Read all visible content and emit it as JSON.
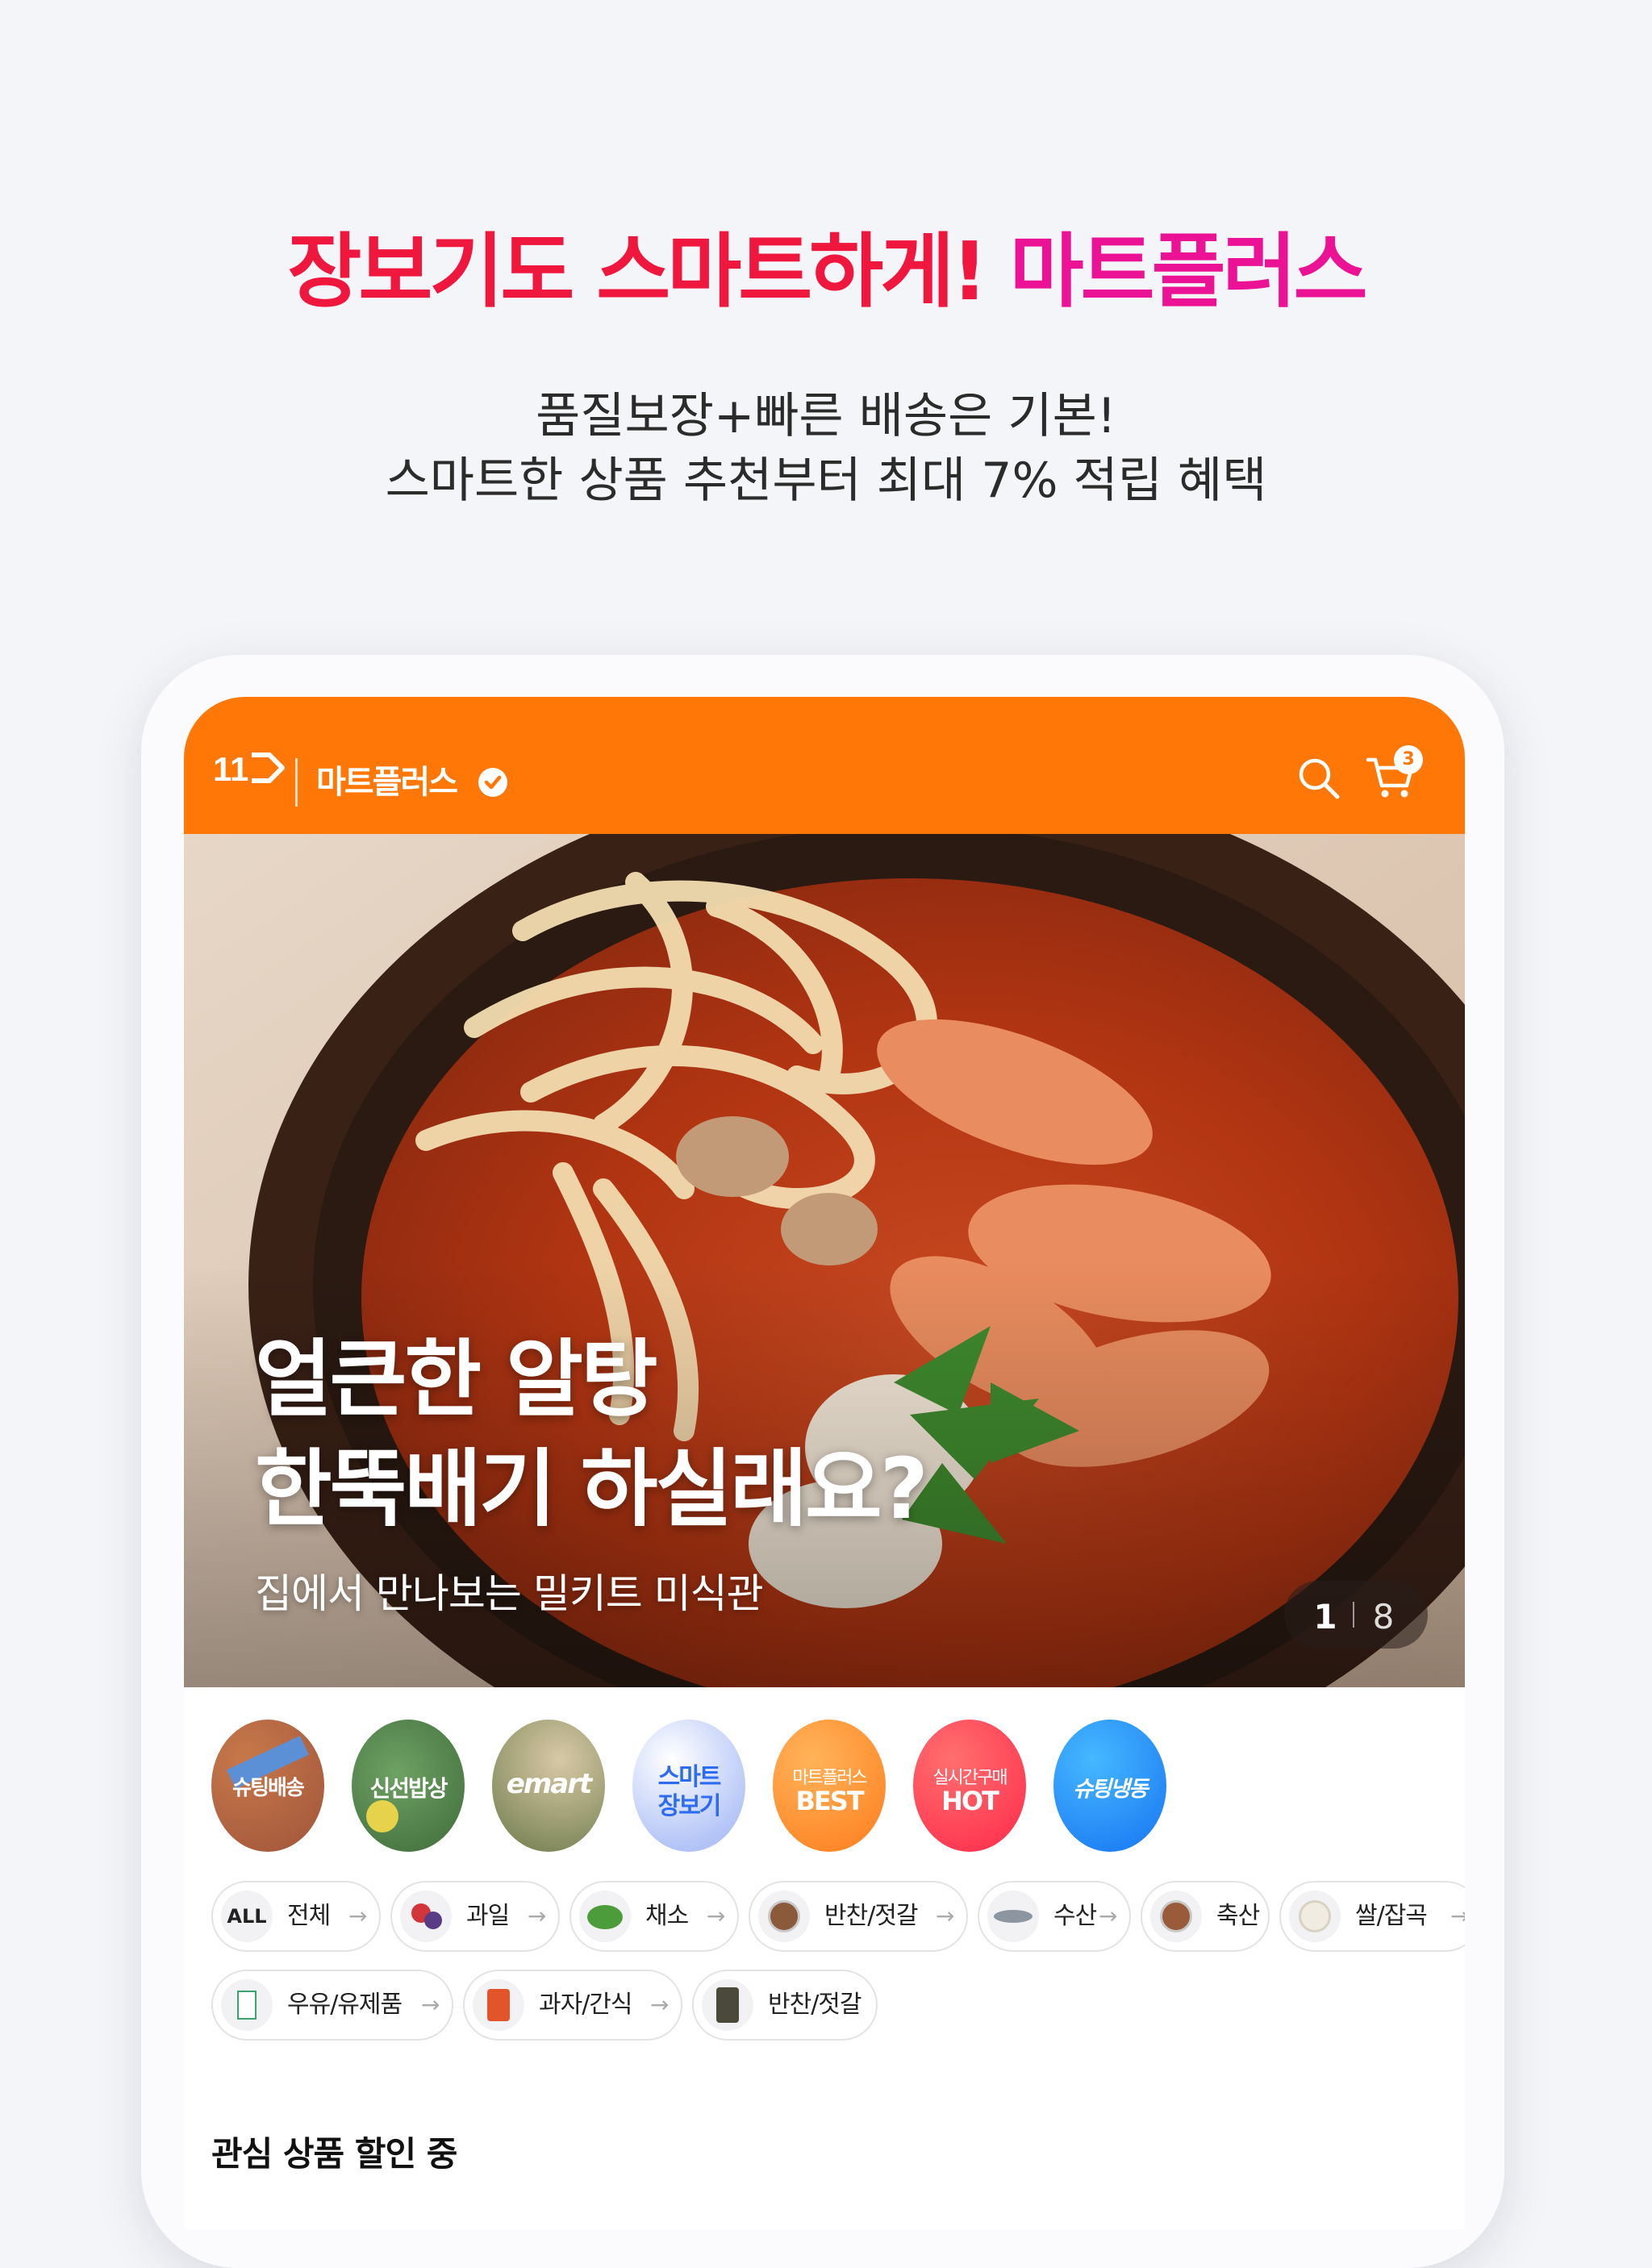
{
  "promo": {
    "headline_part1": "장보기도 스마트하게!",
    "headline_part2": "마트플러스",
    "subline1": "품질보장+빠른 배송은 기본!",
    "subline2": "스마트한 상품 추천부터 최대 7% 적립 혜택"
  },
  "app": {
    "logo_text": "11",
    "brand": "마트플러스",
    "cart_count": "3",
    "accent_color": "#ff7706"
  },
  "hero": {
    "title_line1": "얼큰한 알탕",
    "title_line2": "한뚝배기 하실래요?",
    "subtitle": "집에서 만나보는 밀키트 미식관",
    "current_page": "1",
    "total_pages": "8"
  },
  "shortcuts": [
    {
      "label": "슈팅배송",
      "icon": "shooting-delivery"
    },
    {
      "label": "신선밥상",
      "icon": "fresh-table"
    },
    {
      "label": "emart",
      "icon": "emart-logo"
    },
    {
      "label1": "스마트",
      "label2": "장보기",
      "icon": "smart-shopping"
    },
    {
      "label1": "마트플러스",
      "label2": "BEST",
      "icon": "best-badge"
    },
    {
      "label1": "실시간구매",
      "label2": "HOT",
      "icon": "hot-badge"
    },
    {
      "label": "슈팅냉동",
      "icon": "frozen-delivery"
    }
  ],
  "categories": [
    {
      "label": "전체",
      "icon": "all-icon",
      "badge": "ALL"
    },
    {
      "label": "과일",
      "icon": "fruit-icon"
    },
    {
      "label": "채소",
      "icon": "vegetable-icon"
    },
    {
      "label": "반찬/젓갈",
      "icon": "side-dish-icon"
    },
    {
      "label": "수산",
      "icon": "fish-icon"
    },
    {
      "label": "축산",
      "icon": "meat-icon"
    },
    {
      "label": "쌀/잡곡",
      "icon": "rice-icon"
    },
    {
      "label": "우유/유제품",
      "icon": "milk-icon"
    },
    {
      "label": "과자/간식",
      "icon": "snack-icon"
    },
    {
      "label": "반찬/젓갈",
      "icon": "side-dish-jar-icon"
    }
  ],
  "section": {
    "title": "관심 상품 할인 중"
  }
}
